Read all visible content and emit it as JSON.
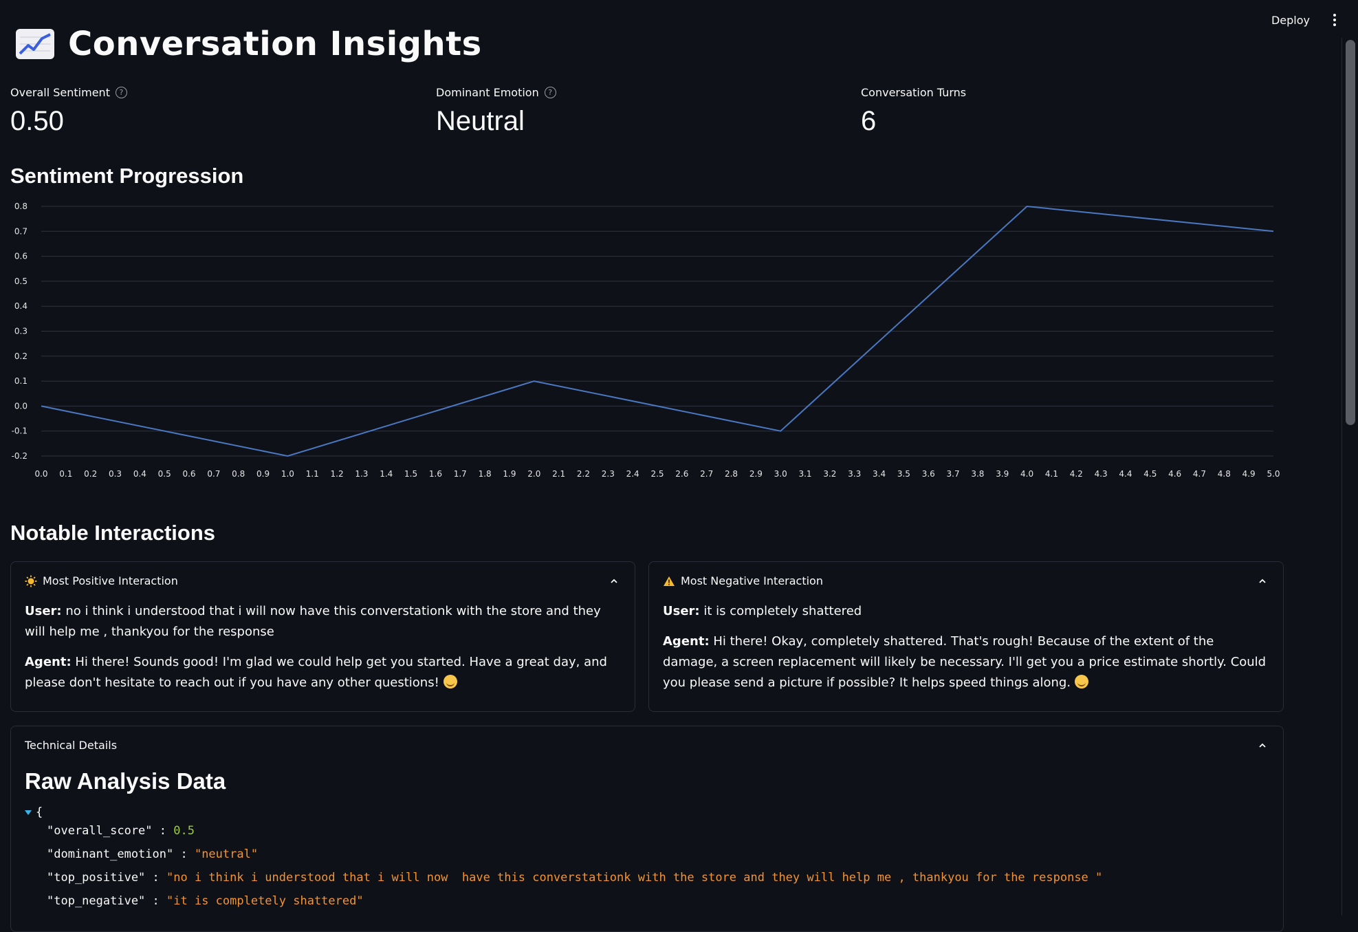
{
  "header": {
    "deploy_label": "Deploy",
    "menu_icon": "kebab-menu-icon"
  },
  "page": {
    "title_emoji": "chart-increasing-icon",
    "title": "Conversation Insights"
  },
  "metrics": [
    {
      "label": "Overall Sentiment",
      "value": "0.50",
      "help": true
    },
    {
      "label": "Dominant Emotion",
      "value": "Neutral",
      "help": true
    },
    {
      "label": "Conversation Turns",
      "value": "6",
      "help": false
    }
  ],
  "sections": {
    "sentiment": "Sentiment Progression",
    "notable": "Notable Interactions"
  },
  "chart_data": {
    "type": "line",
    "x": [
      0,
      1,
      2,
      3,
      4,
      5
    ],
    "values": [
      0.0,
      -0.2,
      0.1,
      -0.1,
      0.8,
      0.7
    ],
    "xlim": [
      0,
      5
    ],
    "ylim": [
      -0.2,
      0.8
    ],
    "xticks": [
      "0.0",
      "0.1",
      "0.2",
      "0.3",
      "0.4",
      "0.5",
      "0.6",
      "0.7",
      "0.8",
      "0.9",
      "1.0",
      "1.1",
      "1.2",
      "1.3",
      "1.4",
      "1.5",
      "1.6",
      "1.7",
      "1.8",
      "1.9",
      "2.0",
      "2.1",
      "2.2",
      "2.3",
      "2.4",
      "2.5",
      "2.6",
      "2.7",
      "2.8",
      "2.9",
      "3.0",
      "3.1",
      "3.2",
      "3.3",
      "3.4",
      "3.5",
      "3.6",
      "3.7",
      "3.8",
      "3.9",
      "4.0",
      "4.1",
      "4.2",
      "4.3",
      "4.4",
      "4.5",
      "4.6",
      "4.7",
      "4.8",
      "4.9",
      "5.0"
    ],
    "yticks": [
      "0.8",
      "0.7",
      "0.6",
      "0.5",
      "0.4",
      "0.3",
      "0.2",
      "0.1",
      "0.0",
      "-0.1",
      "-0.2"
    ],
    "grid": true,
    "line_color": "#4a78c2"
  },
  "positive_card": {
    "icon": "sun-icon",
    "title": "Most Positive Interaction",
    "user_label": "User:",
    "user_text": " no i think i understood that i will now have this converstationk with the store and they will help me , thankyou for the response",
    "agent_label": "Agent:",
    "agent_text": " Hi there! Sounds good! I'm glad we could help get you started. Have a great day, and please don't hesitate to reach out if you have any other questions!"
  },
  "negative_card": {
    "icon": "warning-icon",
    "title": "Most Negative Interaction",
    "user_label": "User:",
    "user_text": " it is completely shattered",
    "agent_label": "Agent:",
    "agent_text": " Hi there! Okay, completely shattered. That's rough! Because of the extent of the damage, a screen replacement will likely be necessary. I'll get you a price estimate shortly. Could you please send a picture if possible? It helps speed things along."
  },
  "technical": {
    "title": "Technical Details",
    "raw_title": "Raw Analysis Data",
    "json_open": "{",
    "rows": [
      {
        "key": "\"overall_score\"",
        "sep": " : ",
        "value": "0.5",
        "kind": "num"
      },
      {
        "key": "\"dominant_emotion\"",
        "sep": " : ",
        "value": "\"neutral\"",
        "kind": "str"
      },
      {
        "key": "\"top_positive\"",
        "sep": " : ",
        "value": "\"no i think i understood that i will now  have this converstationk with the store and they will help me , thankyou for the response \"",
        "kind": "str"
      },
      {
        "key": "\"top_negative\"",
        "sep": " : ",
        "value": "\"it is completely shattered\"",
        "kind": "str"
      }
    ]
  }
}
